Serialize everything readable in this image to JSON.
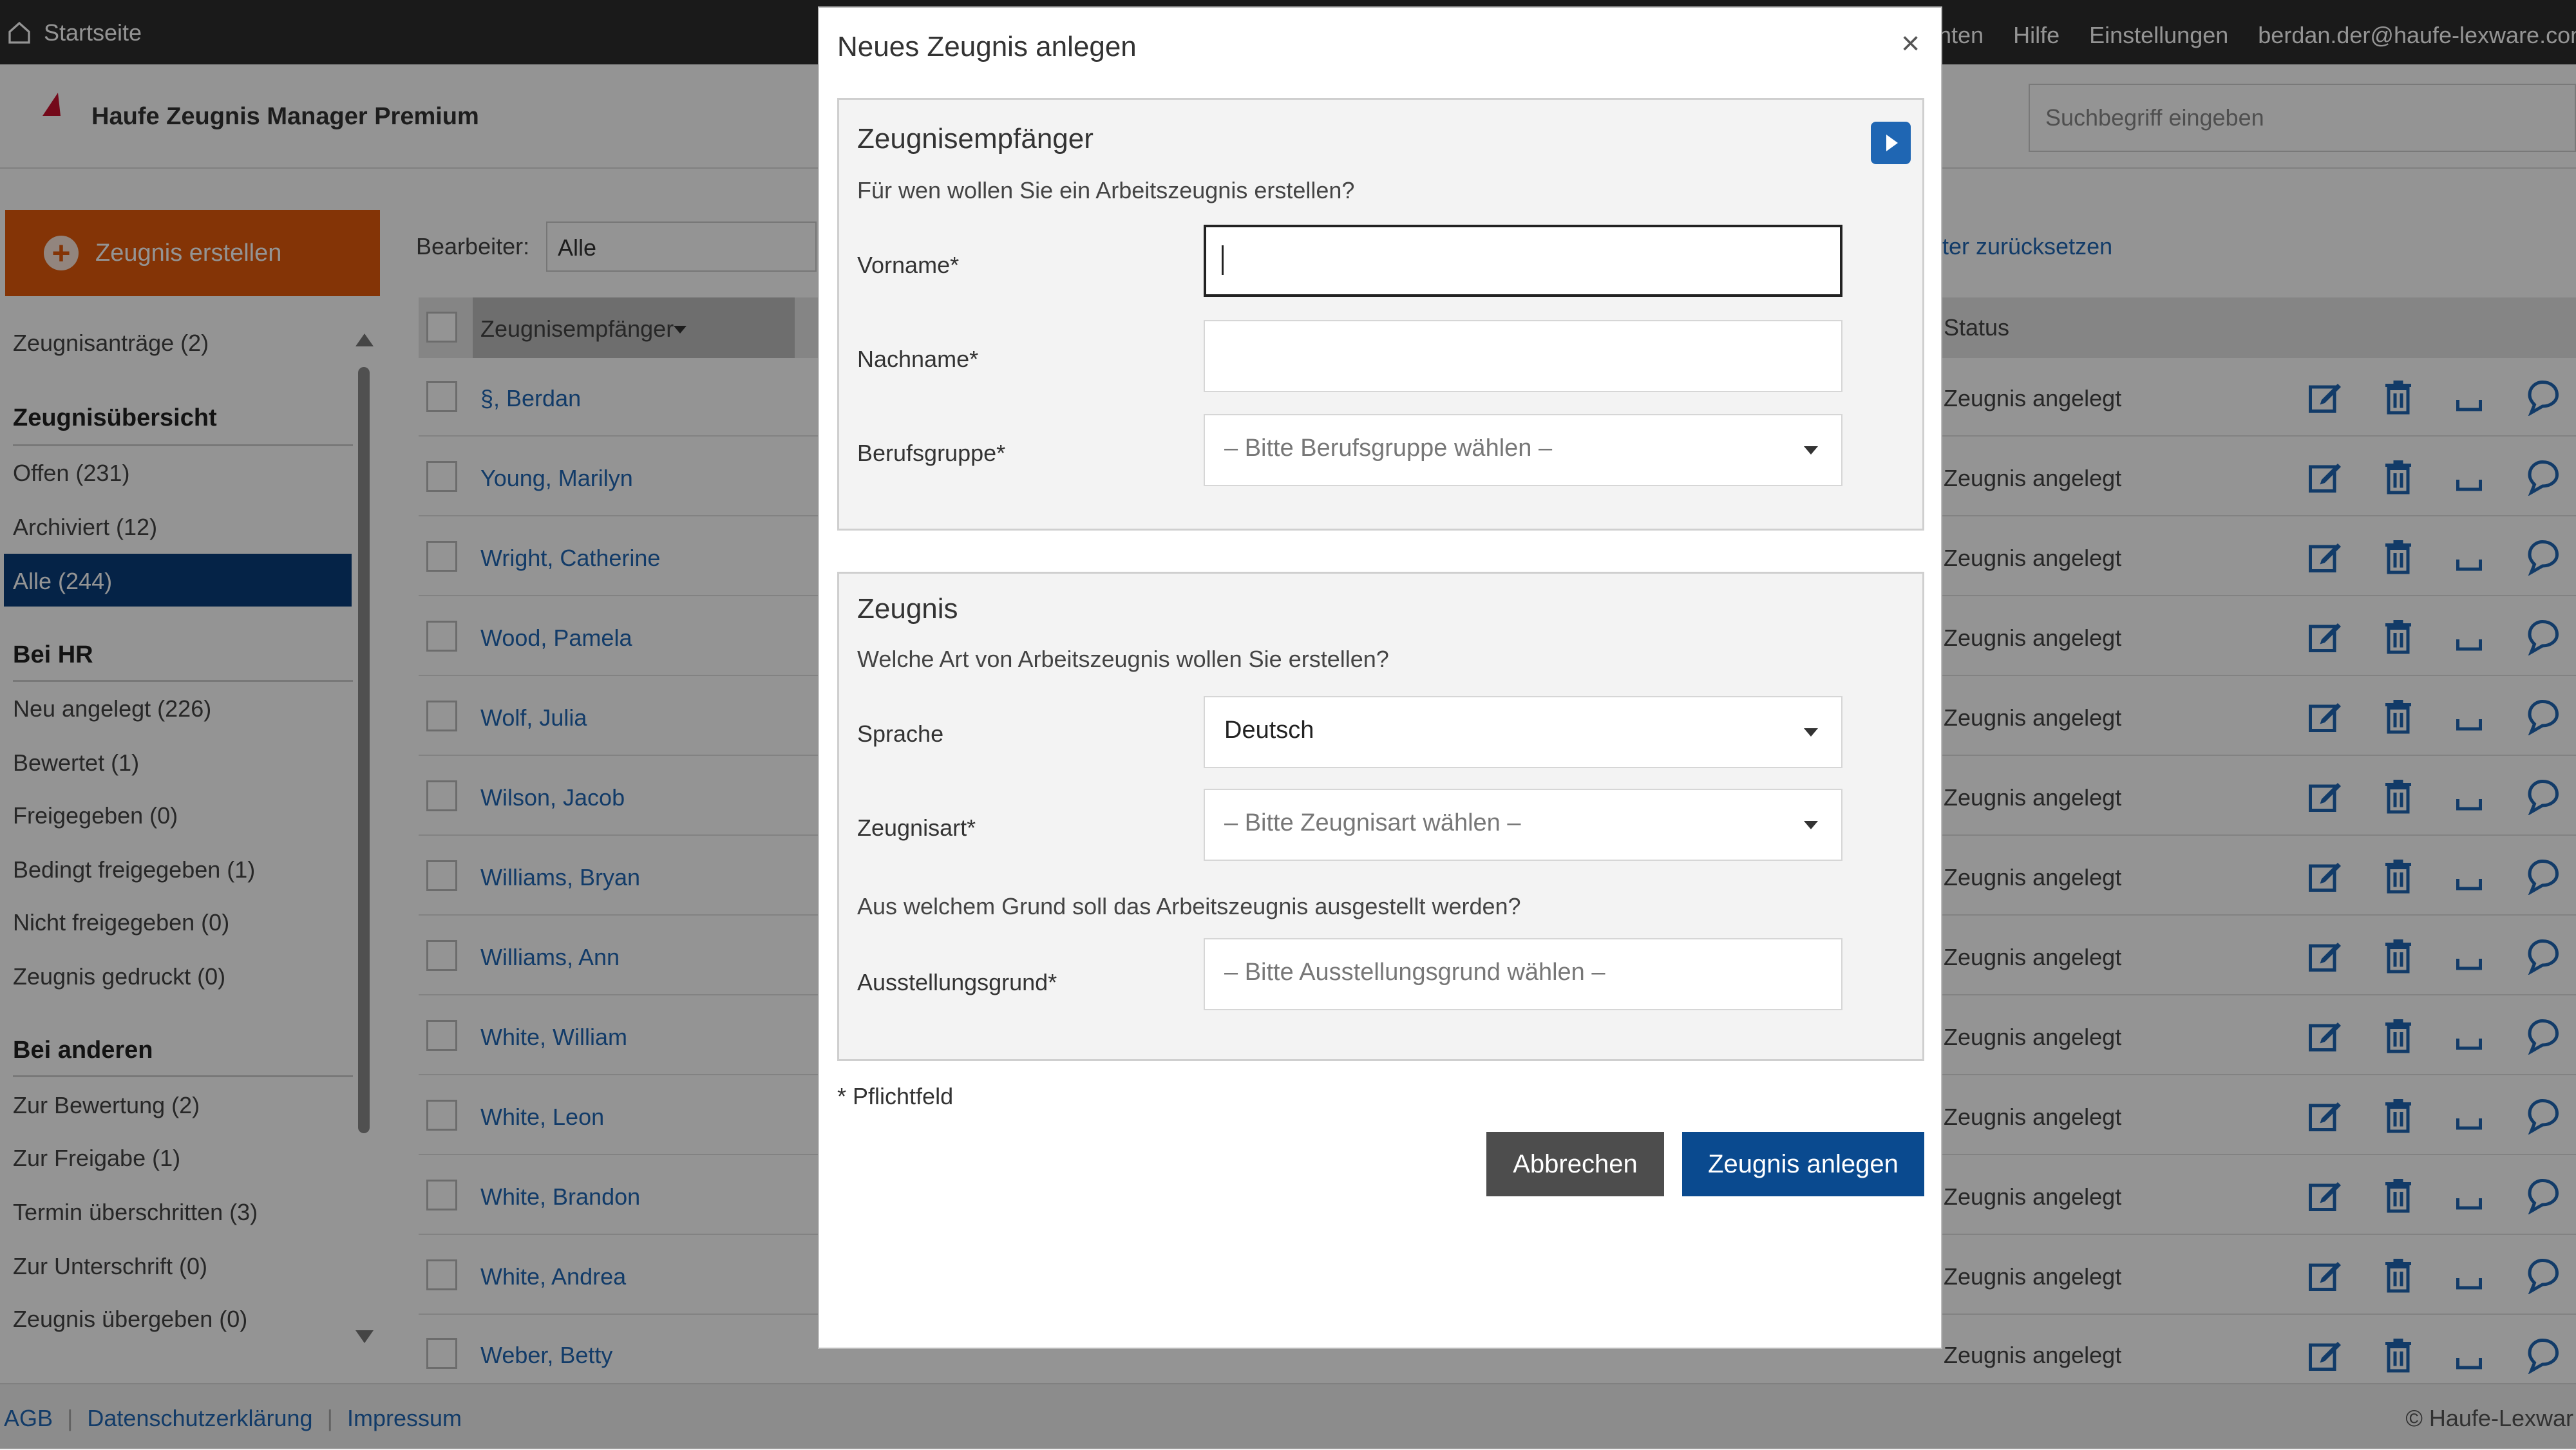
{
  "topbar": {
    "home_label": "Startseite",
    "links": [
      "nten",
      "Hilfe",
      "Einstellungen",
      "berdan.der@haufe-lexware.com (A"
    ]
  },
  "header": {
    "app_title": "Haufe Zeugnis Manager Premium",
    "search_placeholder": "Suchbegriff eingeben"
  },
  "sidebar": {
    "create_button": "Zeugnis erstellen",
    "antraege": "Zeugnisanträge (2)",
    "section_uebersicht": "Zeugnisübersicht",
    "offen": "Offen (231)",
    "archiviert": "Archiviert (12)",
    "alle": "Alle (244)",
    "section_hr": "Bei HR",
    "neu": "Neu angelegt (226)",
    "bewertet": "Bewertet (1)",
    "freigegeben": "Freigegeben (0)",
    "bedingt": "Bedingt freigegeben (1)",
    "nicht": "Nicht freigegeben (0)",
    "gedruckt": "Zeugnis gedruckt (0)",
    "section_andere": "Bei anderen",
    "bewertung": "Zur Bewertung (2)",
    "freigabe": "Zur Freigabe (1)",
    "termin": "Termin überschritten (3)",
    "unterschrift": "Zur Unterschrift (0)",
    "uebergeben": "Zeugnis übergeben (0)"
  },
  "filter": {
    "label": "Bearbeiter:",
    "value": "Alle",
    "reset": "ilter zurücksetzen"
  },
  "table": {
    "col_recipient": "Zeugnisempfänger",
    "col_status": "Status",
    "rows": [
      {
        "name": "§, Berdan",
        "status": "Zeugnis angelegt"
      },
      {
        "name": "Young, Marilyn",
        "status": "Zeugnis angelegt"
      },
      {
        "name": "Wright, Catherine",
        "status": "Zeugnis angelegt"
      },
      {
        "name": "Wood, Pamela",
        "status": "Zeugnis angelegt"
      },
      {
        "name": "Wolf, Julia",
        "status": "Zeugnis angelegt"
      },
      {
        "name": "Wilson, Jacob",
        "status": "Zeugnis angelegt"
      },
      {
        "name": "Williams, Bryan",
        "status": "Zeugnis angelegt"
      },
      {
        "name": "Williams, Ann",
        "status": "Zeugnis angelegt"
      },
      {
        "name": "White, William",
        "status": "Zeugnis angelegt"
      },
      {
        "name": "White, Leon",
        "status": "Zeugnis angelegt"
      },
      {
        "name": "White, Brandon",
        "status": "Zeugnis angelegt"
      },
      {
        "name": "White, Andrea",
        "status": "Zeugnis angelegt"
      },
      {
        "name": "Weber, Betty",
        "status": "Zeugnis angelegt"
      }
    ]
  },
  "footer": {
    "agb": "AGB",
    "datenschutz": "Datenschutzerklärung",
    "impressum": "Impressum",
    "copyright": "© Haufe-Lexwar"
  },
  "modal": {
    "title": "Neues Zeugnis anlegen",
    "close": "×",
    "recipient": {
      "title": "Zeugnisempfänger",
      "subtitle": "Für wen wollen Sie ein Arbeitszeugnis erstellen?",
      "vorname_label": "Vorname*",
      "vorname_value": "",
      "nachname_label": "Nachname*",
      "nachname_value": "",
      "berufsgruppe_label": "Berufsgruppe*",
      "berufsgruppe_placeholder": "– Bitte Berufsgruppe wählen –"
    },
    "zeugnis": {
      "title": "Zeugnis",
      "subtitle": "Welche Art von Arbeitszeugnis wollen Sie erstellen?",
      "sprache_label": "Sprache",
      "sprache_value": "Deutsch",
      "art_label": "Zeugnisart*",
      "art_placeholder": "– Bitte Zeugnisart wählen –",
      "grund_question": "Aus welchem Grund soll das Arbeitszeugnis ausgestellt werden?",
      "grund_label": "Ausstellungsgrund*",
      "grund_placeholder": "– Bitte Ausstellungsgrund wählen –"
    },
    "required_note": "* Pflichtfeld",
    "cancel_button": "Abbrechen",
    "submit_button": "Zeugnis anlegen"
  },
  "colors": {
    "accent_orange": "#e35b0c",
    "primary_blue": "#0a4a8f",
    "link_blue": "#1f66b3",
    "sidebar_active": "#0a3d7a"
  }
}
